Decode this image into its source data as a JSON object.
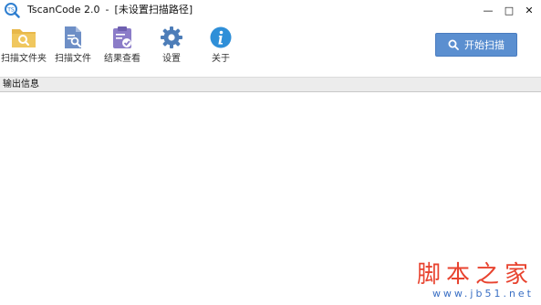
{
  "window": {
    "title_app": "TscanCode 2.0",
    "title_dash": "-",
    "title_path": "[未设置扫描路径]",
    "minimize": "—",
    "maximize": "□",
    "close": "✕"
  },
  "toolbar": {
    "items": [
      {
        "label": "扫描文件夹",
        "icon": "folder-search-icon"
      },
      {
        "label": "扫描文件",
        "icon": "file-search-icon"
      },
      {
        "label": "结果查看",
        "icon": "clipboard-check-icon"
      },
      {
        "label": "设置",
        "icon": "gear-icon"
      },
      {
        "label": "关于",
        "icon": "info-icon"
      }
    ],
    "scan_button": "开始扫描"
  },
  "output": {
    "header": "输出信息"
  },
  "watermark": {
    "text": "脚本之家",
    "url": "www.jb51.net"
  },
  "colors": {
    "accent": "#5b8fd0",
    "folder": "#e8b84a",
    "file": "#6e8fc6",
    "clipboard": "#8b7cc8",
    "gear": "#4d7db8",
    "info": "#2f8fd8",
    "watermark_red": "#e8432f"
  }
}
